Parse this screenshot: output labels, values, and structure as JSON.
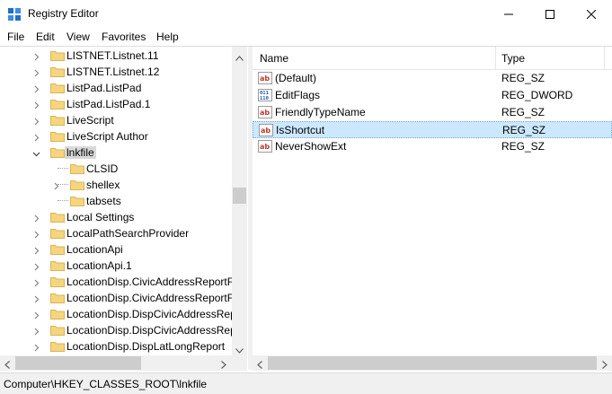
{
  "window": {
    "title": "Registry Editor"
  },
  "menu": [
    "File",
    "Edit",
    "View",
    "Favorites",
    "Help"
  ],
  "tree": {
    "items": [
      {
        "label": "LISTNET.Listnet.11",
        "level": 0,
        "expander": "collapsed"
      },
      {
        "label": "LISTNET.Listnet.12",
        "level": 0,
        "expander": "collapsed"
      },
      {
        "label": "ListPad.ListPad",
        "level": 0,
        "expander": "collapsed"
      },
      {
        "label": "ListPad.ListPad.1",
        "level": 0,
        "expander": "collapsed"
      },
      {
        "label": "LiveScript",
        "level": 0,
        "expander": "collapsed"
      },
      {
        "label": "LiveScript Author",
        "level": 0,
        "expander": "collapsed"
      },
      {
        "label": "lnkfile",
        "level": 0,
        "expander": "expanded",
        "selected": true
      },
      {
        "label": "CLSID",
        "level": 1,
        "expander": "none"
      },
      {
        "label": "shellex",
        "level": 1,
        "expander": "collapsed"
      },
      {
        "label": "tabsets",
        "level": 1,
        "expander": "none"
      },
      {
        "label": "Local Settings",
        "level": 0,
        "expander": "collapsed"
      },
      {
        "label": "LocalPathSearchProvider",
        "level": 0,
        "expander": "collapsed"
      },
      {
        "label": "LocationApi",
        "level": 0,
        "expander": "collapsed"
      },
      {
        "label": "LocationApi.1",
        "level": 0,
        "expander": "collapsed"
      },
      {
        "label": "LocationDisp.CivicAddressReportFa",
        "level": 0,
        "expander": "collapsed"
      },
      {
        "label": "LocationDisp.CivicAddressReportFa",
        "level": 0,
        "expander": "collapsed"
      },
      {
        "label": "LocationDisp.DispCivicAddressRep",
        "level": 0,
        "expander": "collapsed"
      },
      {
        "label": "LocationDisp.DispCivicAddressRep",
        "level": 0,
        "expander": "collapsed"
      },
      {
        "label": "LocationDisp.DispLatLongReport",
        "level": 0,
        "expander": "collapsed"
      }
    ]
  },
  "list": {
    "columns": {
      "name": "Name",
      "type": "Type"
    },
    "rows": [
      {
        "name": "(Default)",
        "type": "REG_SZ",
        "icon": "string-value-icon"
      },
      {
        "name": "EditFlags",
        "type": "REG_DWORD",
        "icon": "binary-value-icon"
      },
      {
        "name": "FriendlyTypeName",
        "type": "REG_SZ",
        "icon": "string-value-icon"
      },
      {
        "name": "IsShortcut",
        "type": "REG_SZ",
        "icon": "string-value-icon",
        "selected": true
      },
      {
        "name": "NeverShowExt",
        "type": "REG_SZ",
        "icon": "string-value-icon"
      }
    ]
  },
  "status": {
    "path": "Computer\\HKEY_CLASSES_ROOT\\lnkfile"
  },
  "colors": {
    "selection": "#cce8ff",
    "folder": "#f5d57e",
    "tree_selection": "#d9d9d9"
  }
}
